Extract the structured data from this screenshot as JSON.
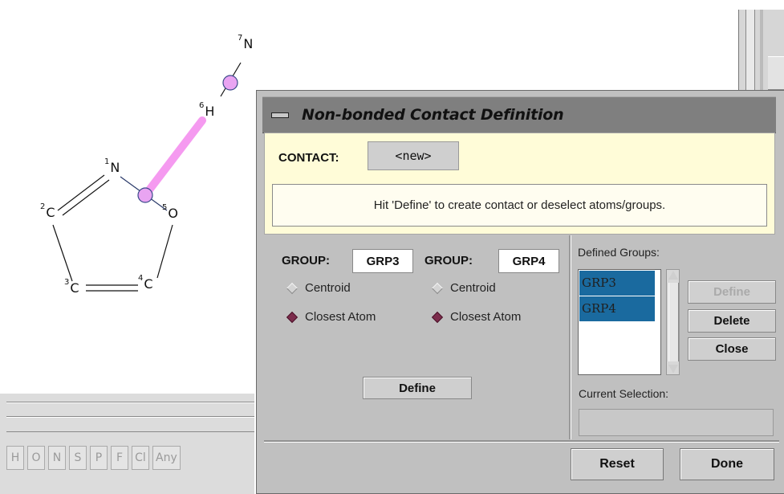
{
  "molecule": {
    "atoms": [
      {
        "num": "1",
        "sym": "N"
      },
      {
        "num": "2",
        "sym": "C"
      },
      {
        "num": "3",
        "sym": "C"
      },
      {
        "num": "4",
        "sym": "C"
      },
      {
        "num": "5",
        "sym": "O"
      },
      {
        "num": "6",
        "sym": "H"
      },
      {
        "num": "7",
        "sym": "N"
      }
    ],
    "highlight_color": "#f59af0",
    "node_color": "#e9a4f2"
  },
  "atom_toolbar": [
    "H",
    "O",
    "N",
    "S",
    "P",
    "F",
    "Cl",
    "Any"
  ],
  "dialog": {
    "title": "Non-bonded Contact Definition",
    "contact_label": "CONTACT:",
    "contact_value": "<new>",
    "message": "Hit 'Define' to create contact or deselect atoms/groups.",
    "group1": {
      "label": "GROUP:",
      "value": "GRP3",
      "options": [
        "Centroid",
        "Closest Atom"
      ],
      "selected": "Closest Atom"
    },
    "group2": {
      "label": "GROUP:",
      "value": "GRP4",
      "options": [
        "Centroid",
        "Closest Atom"
      ],
      "selected": "Closest Atom"
    },
    "define_button": "Define",
    "defined_groups_label": "Defined Groups:",
    "defined_groups": [
      "GRP3",
      "GRP4"
    ],
    "side_buttons": {
      "define": "Define",
      "delete": "Delete",
      "close": "Close"
    },
    "current_selection_label": "Current Selection:",
    "current_selection_value": "",
    "reset_button": "Reset",
    "done_button": "Done"
  },
  "colors": {
    "panel_bg": "#c0c0c0",
    "title_bg": "#7f7f7f",
    "info_bg": "#fffcd8",
    "selected_item": "#1a6a9f"
  }
}
